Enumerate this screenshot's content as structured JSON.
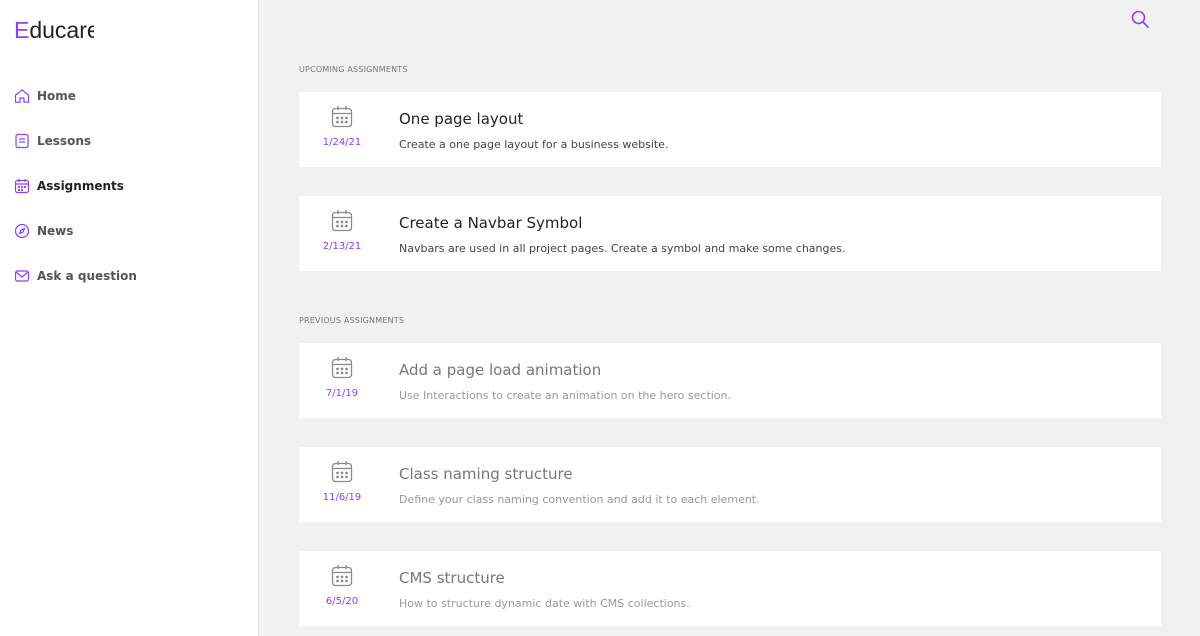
{
  "brand": {
    "first_letter": "E",
    "rest": "ducare"
  },
  "nav": {
    "items": [
      {
        "label": "Home",
        "icon": "home-icon"
      },
      {
        "label": "Lessons",
        "icon": "lessons-icon"
      },
      {
        "label": "Assignments",
        "icon": "calendar-icon",
        "active": true
      },
      {
        "label": "News",
        "icon": "compass-icon"
      },
      {
        "label": "Ask a question",
        "icon": "mail-icon"
      }
    ]
  },
  "search": {
    "icon": "search-icon"
  },
  "upcoming": {
    "title": "UPCOMING ASSIGNMENTS",
    "items": [
      {
        "date": "1/24/21",
        "title": "One page layout",
        "desc": "Create a one page layout for a business website."
      },
      {
        "date": "2/13/21",
        "title": "Create a Navbar Symbol",
        "desc": "Navbars are used in all project pages. Create a symbol and make some changes."
      }
    ]
  },
  "previous": {
    "title": "PREVIOUS ASSIGNMENTS",
    "items": [
      {
        "date": "7/1/19",
        "title": "Add a page load animation",
        "desc": "Use Interactions to create an animation on the hero section."
      },
      {
        "date": "11/6/19",
        "title": "Class naming structure",
        "desc": "Define your class naming convention and add it to each element."
      },
      {
        "date": "6/5/20",
        "title": "CMS structure",
        "desc": "How to structure dynamic date with CMS collections."
      }
    ]
  },
  "colors": {
    "accent": "#8a3ffc",
    "background": "#f1f1f2",
    "card": "#ffffff"
  }
}
